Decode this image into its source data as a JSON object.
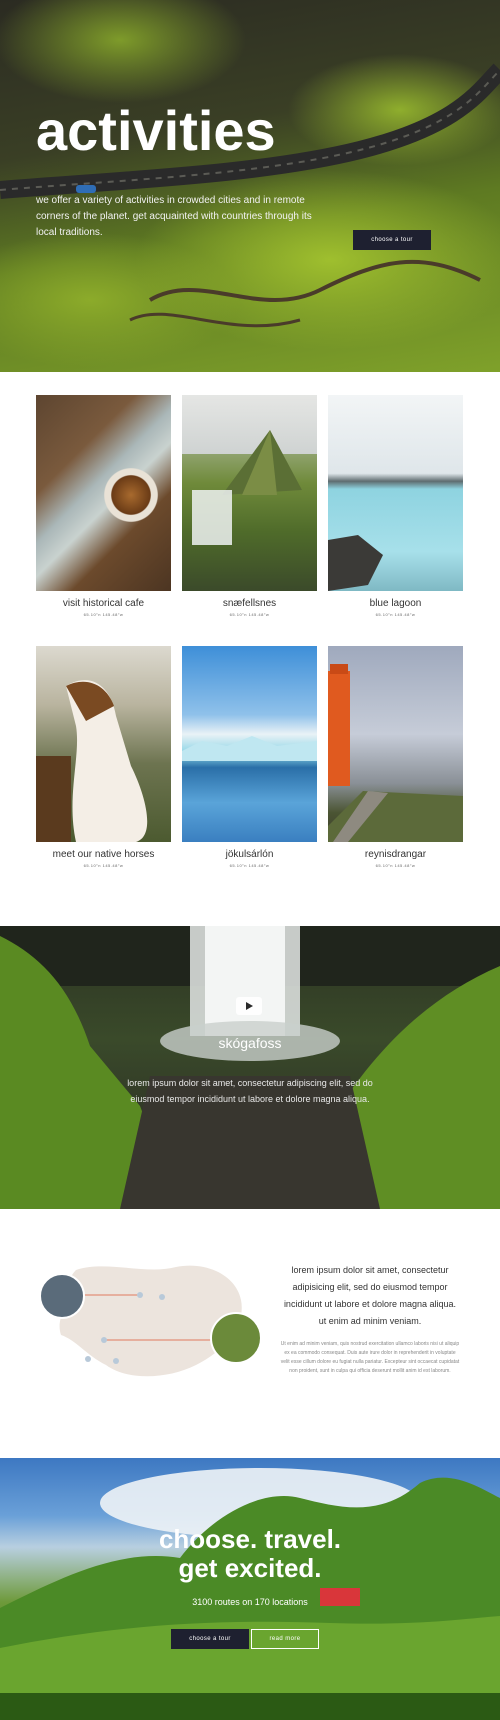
{
  "hero": {
    "title": "activities",
    "text": "we offer a variety of activities in crowded cities and in remote corners of the planet. get acquainted with countries through its local traditions.",
    "button_label": "choose a tour"
  },
  "activities": [
    {
      "name": "visit historical cafe",
      "coords": "65.10°n 145.48°w"
    },
    {
      "name": "snæfellsnes",
      "coords": "65.10°n 145.48°w"
    },
    {
      "name": "blue lagoon",
      "coords": "65.10°n 145.48°w"
    },
    {
      "name": "meet our native horses",
      "coords": "65.10°n 145.48°w"
    },
    {
      "name": "jökulsárlón",
      "coords": "65.10°n 145.48°w"
    },
    {
      "name": "reynisdrangar",
      "coords": "65.10°n 145.48°w"
    }
  ],
  "video": {
    "title": "skógafoss",
    "text": "lorem ipsum dolor sit amet, consectetur adipiscing elit, sed do eiusmod tempor incididunt ut labore et dolore magna aliqua.",
    "icon": "play-icon"
  },
  "map_section": {
    "heading": "lorem ipsum dolor sit amet, consectetur adipisicing elit, sed do eiusmod tempor incididunt ut labore et dolore magna aliqua. ut enim ad minim veniam.",
    "body": "Ut enim ad minim veniam, quis nostrud exercitation ullamco laboris nisi ut aliquip ex ea commodo consequat. Duis aute irure dolor in reprehenderit in voluptate velit esse cillum dolore eu fugiat nulla pariatur. Excepteur sint occaecat cupidatat non proident, sunt in culpa qui officia deserunt mollit anim id est laborum."
  },
  "cta": {
    "title_line1": "choose. travel.",
    "title_line2": "get excited.",
    "subtitle": "3100 routes on 170 locations",
    "primary_button": "choose a tour",
    "secondary_button": "read more"
  },
  "colors": {
    "button_dark": "#1e2030",
    "accent_line": "#e07a5f"
  }
}
